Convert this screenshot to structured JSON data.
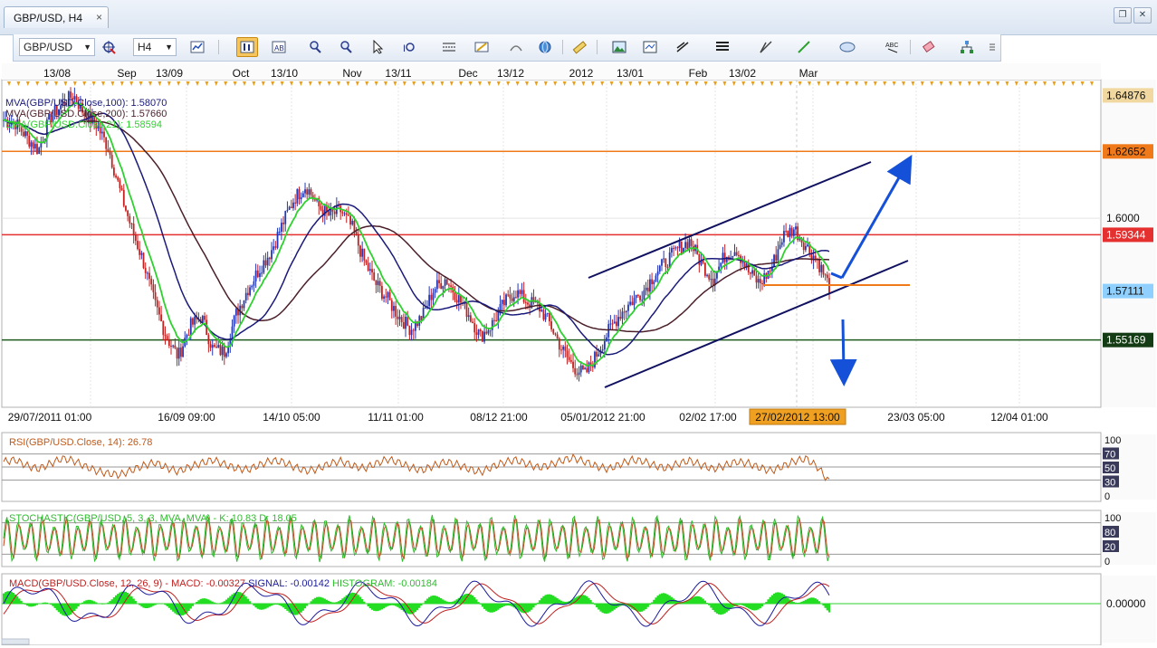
{
  "window": {
    "tab_title": "GBP/USD, H4",
    "close_glyph": "×",
    "restore_glyph": "❐",
    "close_window_glyph": "✕"
  },
  "toolbar": {
    "symbol": "GBP/USD",
    "timeframe": "H4",
    "dropdown_glyph": "▼",
    "icons": [
      "chart-type-icon",
      "crosshair-icon",
      "indicators-icon",
      "bar-chart-icon",
      "text-chart-icon",
      "zoom-in-icon",
      "zoom-out-icon",
      "cursor-icon",
      "zoom-fit-icon",
      "period-separator-icon",
      "properties-icon",
      "drawing-icon",
      "globe-icon",
      "ruler-icon",
      "image-icon",
      "template-icon",
      "lines-icon",
      "fibonacci-icon",
      "pen-icon",
      "draw-line-icon",
      "ellipse-icon",
      "text-label-icon",
      "eraser-icon",
      "objects-tree-icon",
      "more-icon"
    ]
  },
  "colors": {
    "mva100": "#1a1a7a",
    "mva200": "#4b1f2a",
    "ema": "#2ed12e",
    "resistance": "#e53030",
    "top_line": "#f07a1a",
    "support": "#1e5a1e",
    "channel": "#101060",
    "arrow": "#1450d8",
    "bullish": "#2238b8",
    "bearish": "#c42020",
    "rsi_line": "#c05a1a",
    "stoch_k": "#2ebd2e",
    "stoch_d": "#c8401a",
    "macd_line": "#1c1c9c",
    "signal_line": "#c02020",
    "histogram": "#22dd22"
  },
  "chart_data": {
    "type": "candlestick",
    "symbol": "GBP/USD",
    "timeframe": "H4",
    "legend": [
      {
        "text": "MVA(GBP/USD.Close,100): 1.58070",
        "color": "#1a1a7a"
      },
      {
        "text": "MVA(GBP/USD.Close,200): 1.57660",
        "color": "#4b1f2a"
      },
      {
        "text": "EMA(GBP/USD.Close,21): 1.58594",
        "color": "#2ed12e"
      }
    ],
    "top_axis_labels": [
      "13/08",
      "Sep",
      "13/09",
      "Oct",
      "13/10",
      "Nov",
      "13/11",
      "Dec",
      "13/12",
      "2012",
      "13/01",
      "Feb",
      "13/02",
      "Mar"
    ],
    "bottom_axis_labels": [
      "29/07/2011 01:00",
      "16/09 09:00",
      "14/10 05:00",
      "11/11 01:00",
      "08/12 21:00",
      "05/01/2012 21:00",
      "02/02 17:00",
      "23/03 05:00",
      "12/04 01:00"
    ],
    "cursor_time_label": "27/02/2012 13:00",
    "y_axis": {
      "min": 1.525,
      "max": 1.655,
      "tick": "1.6000"
    },
    "price_labels": [
      {
        "value": "1.64876",
        "level": 1.64876,
        "color": "#f0d8a0"
      },
      {
        "value": "1.62652",
        "level": 1.62652,
        "color": "#f07a1a"
      },
      {
        "value": "1.59344",
        "level": 1.59344,
        "color": "#e53030"
      },
      {
        "value": "1.57111",
        "level": 1.57111,
        "color": "#8fd0ff"
      },
      {
        "value": "1.55169",
        "level": 1.55169,
        "color": "#143c14"
      }
    ],
    "horizontal_lines": [
      {
        "name": "top-resistance",
        "level": 1.62652
      },
      {
        "name": "resistance",
        "level": 1.59344
      },
      {
        "name": "support",
        "level": 1.55169
      }
    ],
    "close_path": [
      1.639,
      1.638,
      1.632,
      1.627,
      1.64,
      1.645,
      1.649,
      1.641,
      1.637,
      1.628,
      1.611,
      1.596,
      1.583,
      1.566,
      1.553,
      1.545,
      1.557,
      1.561,
      1.548,
      1.547,
      1.562,
      1.572,
      1.58,
      1.587,
      1.598,
      1.608,
      1.613,
      1.605,
      1.601,
      1.603,
      1.596,
      1.583,
      1.574,
      1.568,
      1.561,
      1.556,
      1.561,
      1.572,
      1.576,
      1.569,
      1.562,
      1.553,
      1.558,
      1.566,
      1.571,
      1.567,
      1.565,
      1.558,
      1.548,
      1.541,
      1.538,
      1.546,
      1.555,
      1.562,
      1.567,
      1.571,
      1.578,
      1.583,
      1.588,
      1.591,
      1.582,
      1.576,
      1.585,
      1.588,
      1.579,
      1.574,
      1.58,
      1.593,
      1.596,
      1.589,
      1.583,
      1.573
    ],
    "rsi": {
      "label": "RSI(GBP/USD.Close, 14): 26.78",
      "levels": [
        "100",
        "70",
        "50",
        "30",
        "0"
      ],
      "values": [
        58,
        61,
        52,
        47,
        55,
        63,
        60,
        51,
        44,
        40,
        38,
        45,
        52,
        57,
        49,
        43,
        50,
        56,
        61,
        54,
        48,
        46,
        53,
        60,
        58,
        50,
        44,
        47,
        55,
        59,
        52,
        48,
        55,
        62,
        57,
        49,
        45,
        52,
        58,
        54,
        47,
        42,
        50,
        57,
        61,
        55,
        49,
        53,
        60,
        64,
        58,
        51,
        47,
        54,
        61,
        59,
        52,
        48,
        55,
        60,
        53,
        47,
        52,
        58,
        56,
        49,
        44,
        51,
        59,
        63,
        50,
        27
      ]
    },
    "stochastic": {
      "label": "STOCHASTIC(GBP/USD, 5, 3, 3, MVA, MVA) -  K: 10.83  D: 18.05",
      "levels": [
        "100",
        "80",
        "20",
        "0"
      ],
      "cycles": 70,
      "last_k": 10.83,
      "last_d": 18.05
    },
    "macd": {
      "label_prefix": "MACD(GBP/USD.Close, 12, 26, 9) -",
      "macd_text": "MACD: -0.00327",
      "signal_text": "SIGNAL: -0.00142",
      "histogram_text": "HISTOGRAM: -0.00184",
      "zero_label": "0.00000"
    }
  }
}
